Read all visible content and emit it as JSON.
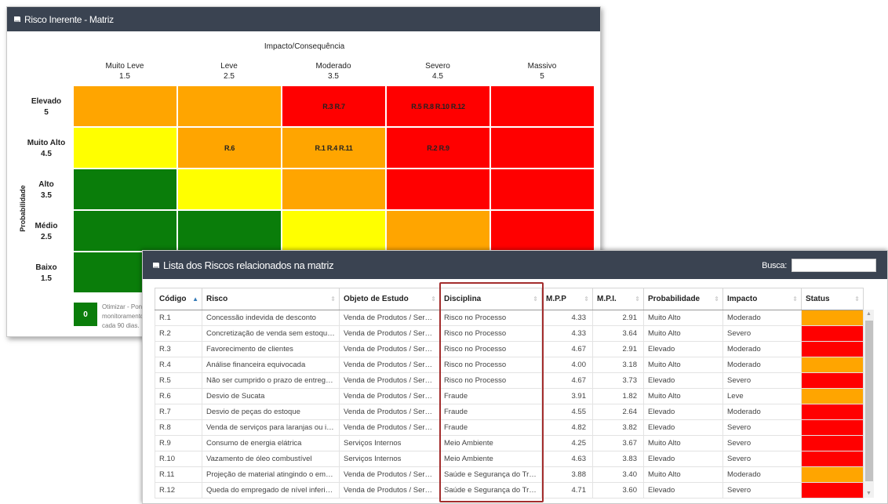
{
  "matrix": {
    "title": "Risco Inerente - Matriz",
    "impact_title": "Impacto/Consequência",
    "probability_label": "Probabilidade",
    "columns": [
      {
        "label": "Muito Leve",
        "value": "1.5"
      },
      {
        "label": "Leve",
        "value": "2.5"
      },
      {
        "label": "Moderado",
        "value": "3.5"
      },
      {
        "label": "Severo",
        "value": "4.5"
      },
      {
        "label": "Massivo",
        "value": "5"
      }
    ],
    "rows": [
      {
        "label": "Elevado",
        "value": "5"
      },
      {
        "label": "Muito Alto",
        "value": "4.5"
      },
      {
        "label": "Alto",
        "value": "3.5"
      },
      {
        "label": "Médio",
        "value": "2.5"
      },
      {
        "label": "Baixo",
        "value": "1.5"
      }
    ],
    "cells": [
      [
        {
          "color": "orange",
          "text": ""
        },
        {
          "color": "orange",
          "text": ""
        },
        {
          "color": "red",
          "text": "R.3 R.7"
        },
        {
          "color": "red",
          "text": "R.5 R.8 R.10 R.12"
        },
        {
          "color": "red",
          "text": ""
        }
      ],
      [
        {
          "color": "yellow",
          "text": ""
        },
        {
          "color": "orange",
          "text": "R.6"
        },
        {
          "color": "orange",
          "text": "R.1 R.4 R.11"
        },
        {
          "color": "red",
          "text": "R.2 R.9"
        },
        {
          "color": "red",
          "text": ""
        }
      ],
      [
        {
          "color": "green",
          "text": ""
        },
        {
          "color": "yellow",
          "text": ""
        },
        {
          "color": "orange",
          "text": ""
        },
        {
          "color": "red",
          "text": ""
        },
        {
          "color": "red",
          "text": ""
        }
      ],
      [
        {
          "color": "green",
          "text": ""
        },
        {
          "color": "green",
          "text": ""
        },
        {
          "color": "yellow",
          "text": ""
        },
        {
          "color": "orange",
          "text": ""
        },
        {
          "color": "red",
          "text": ""
        }
      ],
      [
        {
          "color": "green",
          "text": ""
        },
        {
          "color": "green",
          "text": ""
        },
        {
          "color": "yellow",
          "text": ""
        },
        {
          "color": "orange",
          "text": ""
        },
        {
          "color": "red",
          "text": ""
        }
      ]
    ],
    "legend": {
      "value": "0",
      "text": "Otimizar - Ponto monitoramento cada 90 dias."
    }
  },
  "list": {
    "title": "Lista dos Riscos relacionados na matriz",
    "search_label": "Busca:",
    "search_value": "",
    "columns": [
      "Código",
      "Risco",
      "Objeto de Estudo",
      "Disciplina",
      "M.P.P",
      "M.P.I.",
      "Probabilidade",
      "Impacto",
      "Status"
    ],
    "rows": [
      {
        "codigo": "R.1",
        "risco": "Concessão indevida de desconto",
        "objeto": "Venda de Produtos / Servi...",
        "disciplina": "Risco no Processo",
        "mpp": "4.33",
        "mpi": "2.91",
        "prob": "Muito Alto",
        "impacto": "Moderado",
        "status": "orange"
      },
      {
        "codigo": "R.2",
        "risco": "Concretização de venda sem estoque...",
        "objeto": "Venda de Produtos / Servi...",
        "disciplina": "Risco no Processo",
        "mpp": "4.33",
        "mpi": "3.64",
        "prob": "Muito Alto",
        "impacto": "Severo",
        "status": "red"
      },
      {
        "codigo": "R.3",
        "risco": "Favorecimento de clientes",
        "objeto": "Venda de Produtos / Servi...",
        "disciplina": "Risco no Processo",
        "mpp": "4.67",
        "mpi": "2.91",
        "prob": "Elevado",
        "impacto": "Moderado",
        "status": "red"
      },
      {
        "codigo": "R.4",
        "risco": "Análise financeira equivocada",
        "objeto": "Venda de Produtos / Servi...",
        "disciplina": "Risco no Processo",
        "mpp": "4.00",
        "mpi": "3.18",
        "prob": "Muito Alto",
        "impacto": "Moderado",
        "status": "orange"
      },
      {
        "codigo": "R.5",
        "risco": "Não ser cumprido o prazo de entrega...",
        "objeto": "Venda de Produtos / Servi...",
        "disciplina": "Risco no Processo",
        "mpp": "4.67",
        "mpi": "3.73",
        "prob": "Elevado",
        "impacto": "Severo",
        "status": "red"
      },
      {
        "codigo": "R.6",
        "risco": "Desvio de Sucata",
        "objeto": "Venda de Produtos / Servi...",
        "disciplina": "Fraude",
        "mpp": "3.91",
        "mpi": "1.82",
        "prob": "Muito Alto",
        "impacto": "Leve",
        "status": "orange"
      },
      {
        "codigo": "R.7",
        "risco": "Desvio de peças do estoque",
        "objeto": "Venda de Produtos / Servi...",
        "disciplina": "Fraude",
        "mpp": "4.55",
        "mpi": "2.64",
        "prob": "Elevado",
        "impacto": "Moderado",
        "status": "red"
      },
      {
        "codigo": "R.8",
        "risco": "Venda de serviços para laranjas ou in...",
        "objeto": "Venda de Produtos / Servi...",
        "disciplina": "Fraude",
        "mpp": "4.82",
        "mpi": "3.82",
        "prob": "Elevado",
        "impacto": "Severo",
        "status": "red"
      },
      {
        "codigo": "R.9",
        "risco": "Consumo de energia elátrica",
        "objeto": "Serviços Internos",
        "disciplina": "Meio Ambiente",
        "mpp": "4.25",
        "mpi": "3.67",
        "prob": "Muito Alto",
        "impacto": "Severo",
        "status": "red"
      },
      {
        "codigo": "R.10",
        "risco": "Vazamento de óleo combustível",
        "objeto": "Serviços Internos",
        "disciplina": "Meio Ambiente",
        "mpp": "4.63",
        "mpi": "3.83",
        "prob": "Elevado",
        "impacto": "Severo",
        "status": "red"
      },
      {
        "codigo": "R.11",
        "risco": "Projeção de material atingindo o emp...",
        "objeto": "Venda de Produtos / Servi...",
        "disciplina": "Saúde e Segurança do Tra...",
        "mpp": "3.88",
        "mpi": "3.40",
        "prob": "Muito Alto",
        "impacto": "Moderado",
        "status": "orange"
      },
      {
        "codigo": "R.12",
        "risco": "Queda do empregado de nível inferio...",
        "objeto": "Venda de Produtos / Servi...",
        "disciplina": "Saúde e Segurança do Tra...",
        "mpp": "4.71",
        "mpi": "3.60",
        "prob": "Elevado",
        "impacto": "Severo",
        "status": "red"
      }
    ]
  },
  "colors": {
    "green": "#0a7d0a",
    "yellow": "#ffff00",
    "orange": "#ffa500",
    "red": "#ff0000",
    "header": "#3a4351",
    "highlight": "#a32d2d"
  }
}
